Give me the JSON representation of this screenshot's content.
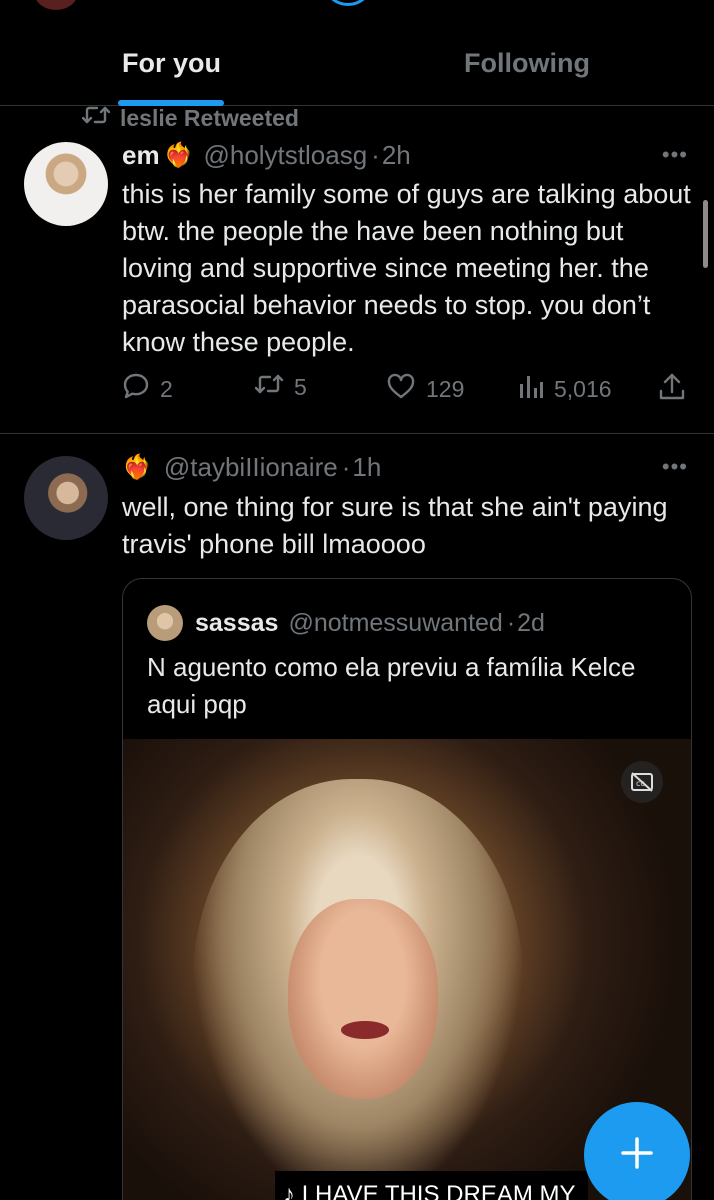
{
  "tabs": [
    {
      "label": "For you",
      "active": true
    },
    {
      "label": "Following",
      "active": false
    }
  ],
  "colors": {
    "accent": "#1d9bf0",
    "muted": "#71767b",
    "text": "#e7e9ea",
    "background": "#000000"
  },
  "tweet1": {
    "retweet_label": "leslie Retweeted",
    "name": "em",
    "name_emoji": "❤️‍🔥",
    "handle": "@holytstloasg",
    "separator": "·",
    "time": "2h",
    "text": "this is her family some of guys are talking about btw. the people the have been nothing but loving and supportive since meeting her. the parasocial behavior needs to stop. you don’t know these people.",
    "replies": "2",
    "retweets": "5",
    "likes": "129",
    "views": "5,016"
  },
  "tweet2": {
    "name_emoji": "❤️‍🔥",
    "handle": "@taybiIIionaire",
    "separator": "·",
    "time": "1h",
    "text": "well, one thing for sure is that she ain't paying travis' phone bill lmaoooo",
    "quote": {
      "name": "sassas",
      "handle": "@notmessuwanted",
      "separator": "·",
      "time": "2d",
      "text": "N aguento como ela previu a família Kelce aqui pqp",
      "video_caption": "♪ I HAVE THIS DREAM MY"
    }
  },
  "icons": [
    "retweet-icon",
    "more-icon",
    "reply-icon",
    "like-icon",
    "views-icon",
    "share-icon",
    "captions-icon",
    "compose-plus-icon"
  ]
}
